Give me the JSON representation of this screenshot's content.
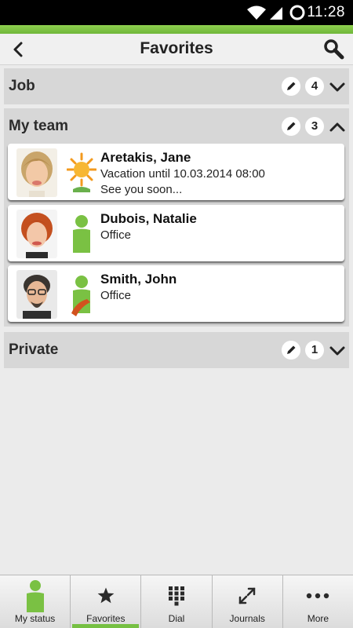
{
  "status_bar": {
    "time": "11:28"
  },
  "header": {
    "title": "Favorites"
  },
  "groups": [
    {
      "title": "Job",
      "count": "4",
      "expanded": false
    },
    {
      "title": "My team",
      "count": "3",
      "expanded": true
    },
    {
      "title": "Private",
      "count": "1",
      "expanded": false
    }
  ],
  "contacts": [
    {
      "name": "Aretakis, Jane",
      "status_icon": "vacation-sun-icon",
      "line1": "Vacation until 10.03.2014 08:00",
      "line2": "See you soon..."
    },
    {
      "name": "Dubois, Natalie",
      "status_icon": "available-person-icon",
      "line1": "Office"
    },
    {
      "name": "Smith, John",
      "status_icon": "on-phone-person-icon",
      "line1": "Office"
    }
  ],
  "bottom_nav": [
    {
      "label": "My status",
      "icon": "person-status-icon"
    },
    {
      "label": "Favorites",
      "icon": "star-icon",
      "active": true
    },
    {
      "label": "Dial",
      "icon": "dialpad-icon"
    },
    {
      "label": "Journals",
      "icon": "call-arrows-icon"
    },
    {
      "label": "More",
      "icon": "more-dots-icon"
    }
  ],
  "colors": {
    "accent": "#76c043",
    "group_bg": "#d7d7d7",
    "page_bg": "#ebebeb"
  }
}
